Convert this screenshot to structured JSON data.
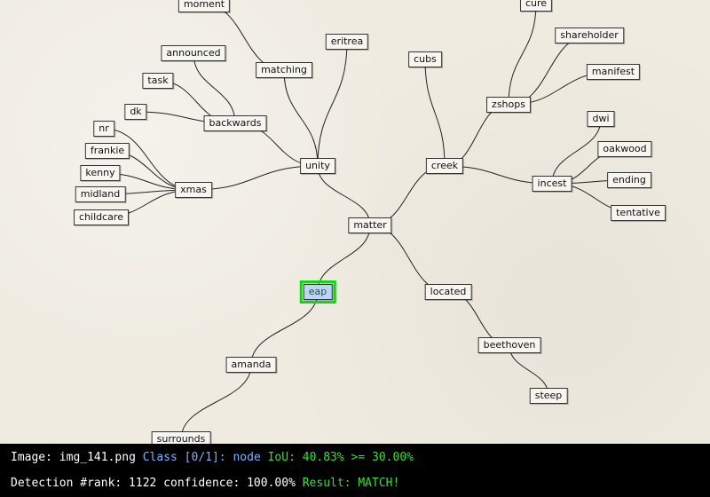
{
  "diagram": {
    "nodes": [
      {
        "id": "moment",
        "label": "moment"
      },
      {
        "id": "eritrea",
        "label": "eritrea"
      },
      {
        "id": "cure",
        "label": "cure"
      },
      {
        "id": "shareholder",
        "label": "shareholder"
      },
      {
        "id": "announced",
        "label": "announced"
      },
      {
        "id": "cubs",
        "label": "cubs"
      },
      {
        "id": "matching",
        "label": "matching"
      },
      {
        "id": "manifest",
        "label": "manifest"
      },
      {
        "id": "task",
        "label": "task"
      },
      {
        "id": "zshops",
        "label": "zshops"
      },
      {
        "id": "dk",
        "label": "dk"
      },
      {
        "id": "dwi",
        "label": "dwi"
      },
      {
        "id": "backwards",
        "label": "backwards"
      },
      {
        "id": "nr",
        "label": "nr"
      },
      {
        "id": "frankie",
        "label": "frankie"
      },
      {
        "id": "oakwood",
        "label": "oakwood"
      },
      {
        "id": "unity",
        "label": "unity"
      },
      {
        "id": "creek",
        "label": "creek"
      },
      {
        "id": "kenny",
        "label": "kenny"
      },
      {
        "id": "ending",
        "label": "ending"
      },
      {
        "id": "incest",
        "label": "incest"
      },
      {
        "id": "xmas",
        "label": "xmas"
      },
      {
        "id": "midland",
        "label": "midland"
      },
      {
        "id": "tentative",
        "label": "tentative"
      },
      {
        "id": "childcare",
        "label": "childcare"
      },
      {
        "id": "matter",
        "label": "matter"
      },
      {
        "id": "eap",
        "label": "eap",
        "selected": true
      },
      {
        "id": "located",
        "label": "located"
      },
      {
        "id": "beethoven",
        "label": "beethoven"
      },
      {
        "id": "amanda",
        "label": "amanda"
      },
      {
        "id": "steep",
        "label": "steep"
      },
      {
        "id": "surrounds",
        "label": "surrounds"
      }
    ],
    "edges": [
      [
        "matter",
        "unity"
      ],
      [
        "matter",
        "creek"
      ],
      [
        "matter",
        "eap"
      ],
      [
        "matter",
        "located"
      ],
      [
        "unity",
        "matching"
      ],
      [
        "unity",
        "eritrea"
      ],
      [
        "unity",
        "backwards"
      ],
      [
        "unity",
        "xmas"
      ],
      [
        "matching",
        "moment"
      ],
      [
        "backwards",
        "announced"
      ],
      [
        "backwards",
        "task"
      ],
      [
        "backwards",
        "dk"
      ],
      [
        "xmas",
        "nr"
      ],
      [
        "xmas",
        "frankie"
      ],
      [
        "xmas",
        "kenny"
      ],
      [
        "xmas",
        "midland"
      ],
      [
        "xmas",
        "childcare"
      ],
      [
        "creek",
        "cubs"
      ],
      [
        "creek",
        "zshops"
      ],
      [
        "creek",
        "incest"
      ],
      [
        "zshops",
        "cure"
      ],
      [
        "zshops",
        "shareholder"
      ],
      [
        "zshops",
        "manifest"
      ],
      [
        "incest",
        "dwi"
      ],
      [
        "incest",
        "oakwood"
      ],
      [
        "incest",
        "ending"
      ],
      [
        "incest",
        "tentative"
      ],
      [
        "located",
        "beethoven"
      ],
      [
        "beethoven",
        "steep"
      ],
      [
        "eap",
        "amanda"
      ],
      [
        "amanda",
        "surrounds"
      ]
    ]
  },
  "status": {
    "image_label": "Image:",
    "image_name": "img_141.png",
    "class_text": "Class [0/1]: node",
    "iou_text": "IoU: 40.83% >= 30.00%",
    "detection_text": "Detection #rank: 1122 confidence: 100.00%",
    "result_text": "Result: MATCH!"
  },
  "colors": {
    "status_white": "#ffffff",
    "status_blue": "#7fb0ff",
    "status_green": "#3ddc3d",
    "highlight": "#17d417"
  }
}
